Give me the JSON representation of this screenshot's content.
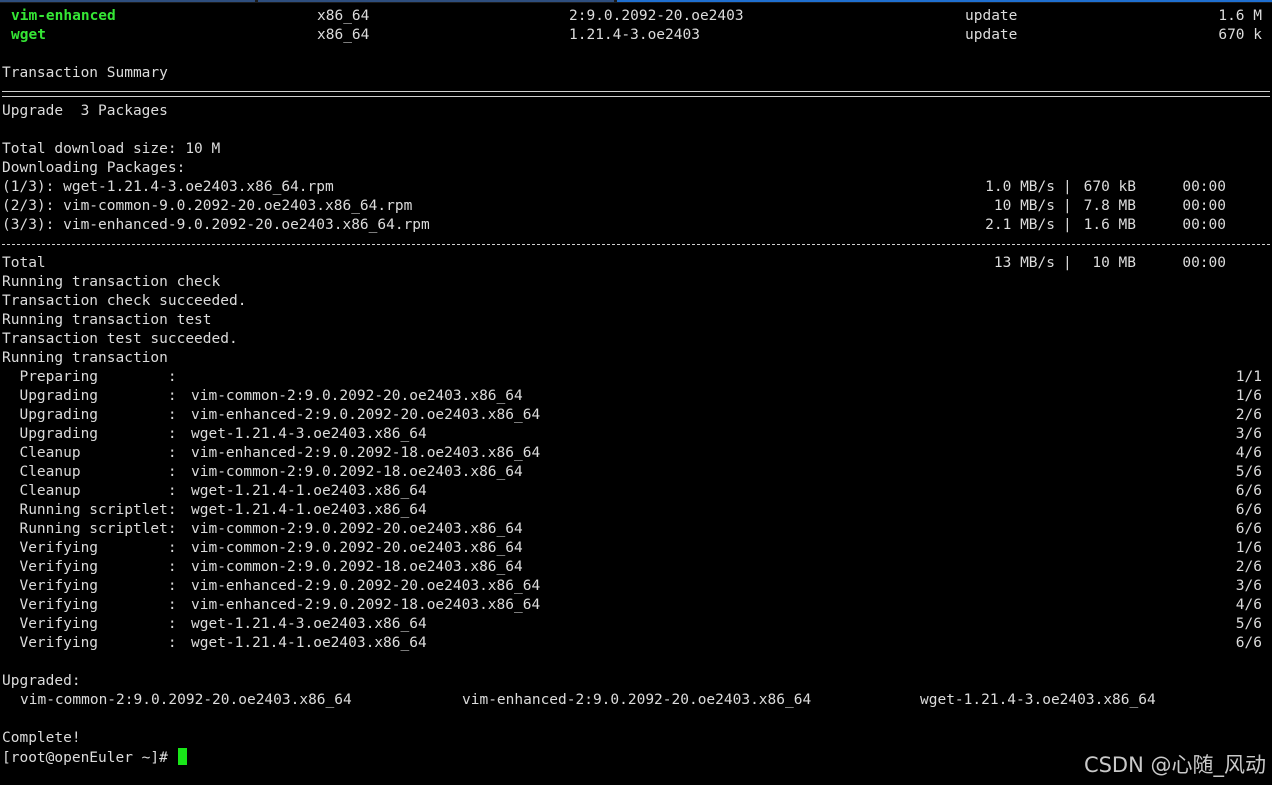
{
  "packages": [
    {
      "name": "vim-enhanced",
      "arch": "x86_64",
      "version": "2:9.0.2092-20.oe2403",
      "repo": "update",
      "size": "1.6 M"
    },
    {
      "name": "wget",
      "arch": "x86_64",
      "version": "1.21.4-3.oe2403",
      "repo": "update",
      "size": "670 k"
    }
  ],
  "summary_title": "Transaction Summary",
  "upgrade_line": "Upgrade  3 Packages",
  "total_download": "Total download size: 10 M",
  "downloading_title": "Downloading Packages:",
  "downloads": [
    {
      "label": "(1/3): wget-1.21.4-3.oe2403.x86_64.rpm",
      "speed": "1.0 MB/s",
      "size": "670 kB",
      "time": "00:00"
    },
    {
      "label": "(2/3): vim-common-9.0.2092-20.oe2403.x86_64.rpm",
      "speed": "10 MB/s",
      "size": "7.8 MB",
      "time": "00:00"
    },
    {
      "label": "(3/3): vim-enhanced-9.0.2092-20.oe2403.x86_64.rpm",
      "speed": "2.1 MB/s",
      "size": "1.6 MB",
      "time": "00:00"
    }
  ],
  "total": {
    "label": "Total",
    "speed": "13 MB/s",
    "size": "10 MB",
    "time": "00:00"
  },
  "messages": [
    "Running transaction check",
    "Transaction check succeeded.",
    "Running transaction test",
    "Transaction test succeeded.",
    "Running transaction"
  ],
  "steps": [
    {
      "action": "  Preparing        :",
      "pkg": "",
      "count": "1/1"
    },
    {
      "action": "  Upgrading        :",
      "pkg": "vim-common-2:9.0.2092-20.oe2403.x86_64",
      "count": "1/6"
    },
    {
      "action": "  Upgrading        :",
      "pkg": "vim-enhanced-2:9.0.2092-20.oe2403.x86_64",
      "count": "2/6"
    },
    {
      "action": "  Upgrading        :",
      "pkg": "wget-1.21.4-3.oe2403.x86_64",
      "count": "3/6"
    },
    {
      "action": "  Cleanup          :",
      "pkg": "vim-enhanced-2:9.0.2092-18.oe2403.x86_64",
      "count": "4/6"
    },
    {
      "action": "  Cleanup          :",
      "pkg": "vim-common-2:9.0.2092-18.oe2403.x86_64",
      "count": "5/6"
    },
    {
      "action": "  Cleanup          :",
      "pkg": "wget-1.21.4-1.oe2403.x86_64",
      "count": "6/6"
    },
    {
      "action": "  Running scriptlet:",
      "pkg": "wget-1.21.4-1.oe2403.x86_64",
      "count": "6/6"
    },
    {
      "action": "  Running scriptlet:",
      "pkg": "vim-common-2:9.0.2092-20.oe2403.x86_64",
      "count": "6/6"
    },
    {
      "action": "  Verifying        :",
      "pkg": "vim-common-2:9.0.2092-20.oe2403.x86_64",
      "count": "1/6"
    },
    {
      "action": "  Verifying        :",
      "pkg": "vim-common-2:9.0.2092-18.oe2403.x86_64",
      "count": "2/6"
    },
    {
      "action": "  Verifying        :",
      "pkg": "vim-enhanced-2:9.0.2092-20.oe2403.x86_64",
      "count": "3/6"
    },
    {
      "action": "  Verifying        :",
      "pkg": "vim-enhanced-2:9.0.2092-18.oe2403.x86_64",
      "count": "4/6"
    },
    {
      "action": "  Verifying        :",
      "pkg": "wget-1.21.4-3.oe2403.x86_64",
      "count": "5/6"
    },
    {
      "action": "  Verifying        :",
      "pkg": "wget-1.21.4-1.oe2403.x86_64",
      "count": "6/6"
    }
  ],
  "upgraded_title": "Upgraded:",
  "upgraded": [
    "vim-common-2:9.0.2092-20.oe2403.x86_64",
    "vim-enhanced-2:9.0.2092-20.oe2403.x86_64",
    "wget-1.21.4-3.oe2403.x86_64"
  ],
  "complete": "Complete!",
  "prompt": "[root@openEuler ~]# ",
  "watermark": "CSDN @心随_风动",
  "colors": {
    "background": "#000000",
    "text": "#dcdcdc",
    "package_name": "#35e635",
    "cursor": "#19e619"
  }
}
